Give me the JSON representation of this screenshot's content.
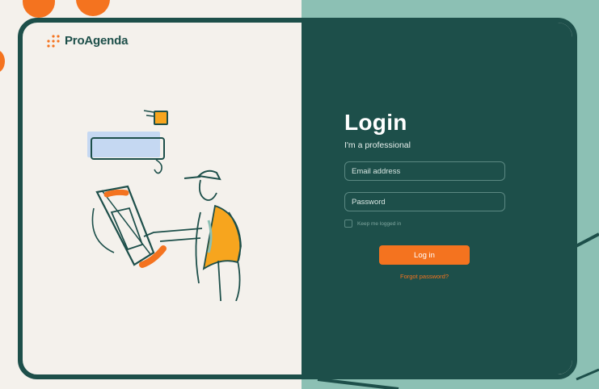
{
  "brand": {
    "name": "ProAgenda"
  },
  "login": {
    "title": "Login",
    "subtitle": "I'm a professional",
    "email_placeholder": "Email address",
    "password_placeholder": "Password",
    "remember_label": "Keep me logged in",
    "submit_label": "Log in",
    "forgot_label": "Forgot password?"
  },
  "colors": {
    "brand_dark": "#1d4f4a",
    "accent": "#f4731f",
    "background": "#f4f1ec",
    "teal_light": "#8cc0b4"
  },
  "icons": {
    "logo": "dot-grid-logo-icon",
    "illustration": "delivery-person-tablet-illustration"
  }
}
